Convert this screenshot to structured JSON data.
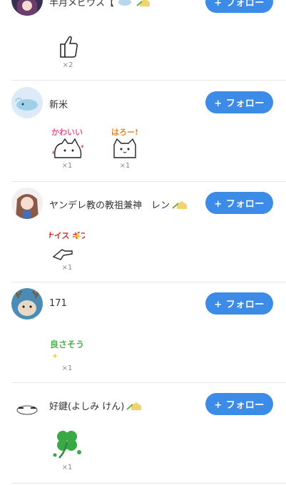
{
  "follow_label": "+ フォロー",
  "entries": [
    {
      "user_name": "半月メビウス【",
      "stamps": [
        {
          "text": "ナイス",
          "count": "×2"
        }
      ]
    },
    {
      "user_name": "新米",
      "stamps": [
        {
          "text": "かわいい",
          "count": "×1"
        },
        {
          "text": "はろー!",
          "count": "×1"
        }
      ]
    },
    {
      "user_name": "ヤンデレ教の教祖兼神　レン",
      "stamps": [
        {
          "text": "ナイス ギフ",
          "count": "×1"
        }
      ]
    },
    {
      "user_name": "171",
      "stamps": [
        {
          "text": "良さそう",
          "count": "×1"
        }
      ]
    },
    {
      "user_name": "好鍵(よしみ けん)",
      "stamps": [
        {
          "text": "",
          "count": "×1"
        }
      ]
    }
  ]
}
